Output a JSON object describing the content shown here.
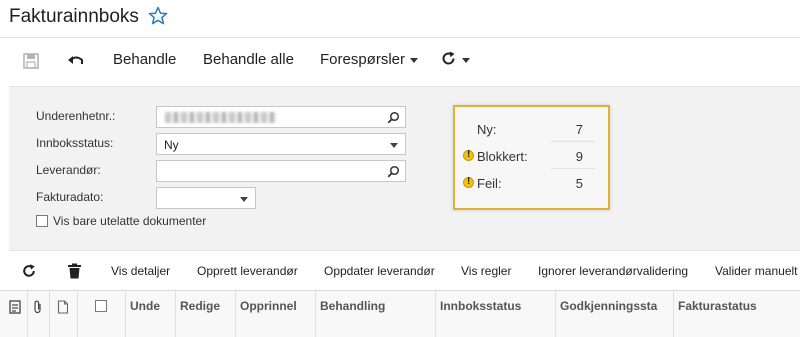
{
  "header": {
    "title": "Fakturainnboks",
    "favorite_icon": "star-icon"
  },
  "toolbar": {
    "save_icon": "save-icon",
    "undo_icon": "undo-icon",
    "process_label": "Behandle",
    "process_all_label": "Behandle alle",
    "inquiries_label": "Forespørsler",
    "refresh_icon": "refresh-icon"
  },
  "filters": {
    "subsidiary_label": "Underenhetnr.:",
    "subsidiary_value_masked": true,
    "inbox_status_label": "Innboksstatus:",
    "inbox_status_value": "Ny",
    "supplier_label": "Leverandør:",
    "supplier_value": "",
    "invoice_date_label": "Fakturadato:",
    "invoice_date_value": "",
    "show_only_unapproved_label": "Vis bare utelatte dokumenter",
    "show_only_unapproved_checked": false
  },
  "summary": {
    "rows": [
      {
        "label": "Ny:",
        "value": "7",
        "warning": false
      },
      {
        "label": "Blokkert:",
        "value": "9",
        "warning": true
      },
      {
        "label": "Feil:",
        "value": "5",
        "warning": true
      }
    ],
    "border_color": "#e0b234",
    "warning_color": "#f4c20d"
  },
  "grid_toolbar": {
    "refresh_icon": "refresh-icon",
    "delete_icon": "trash-icon",
    "show_details": "Vis detaljer",
    "create_supplier": "Opprett leverandør",
    "update_supplier": "Oppdater leverandør",
    "show_rules": "Vis regler",
    "ignore_supplier_validation": "Ignorer leverandørvalidering",
    "validate_manually": "Valider manuelt"
  },
  "grid": {
    "columns": [
      "Unde",
      "Redige",
      "Opprinnel",
      "Behandling",
      "Innboksstatus",
      "Godkjenningssta",
      "Fakturastatus"
    ]
  }
}
